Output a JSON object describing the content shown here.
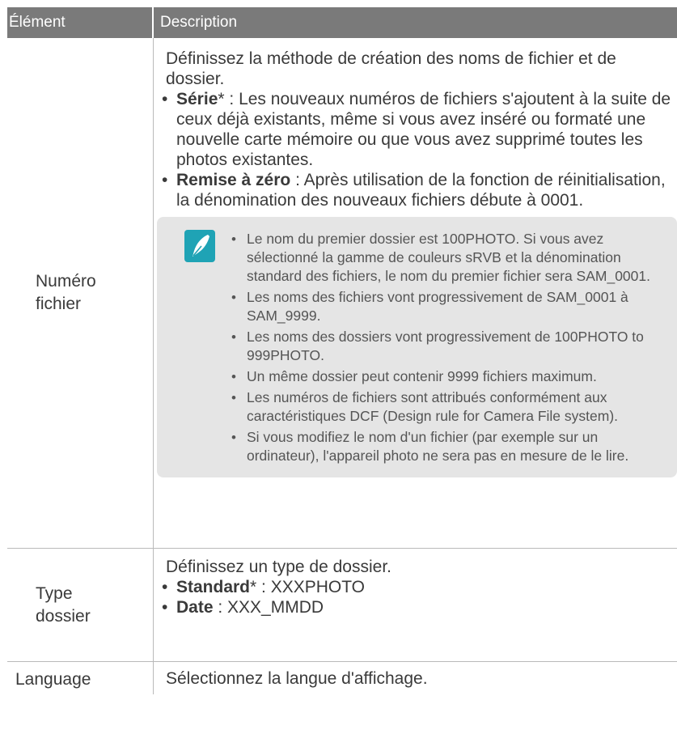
{
  "header": {
    "col1": "Élément",
    "col2": "Description"
  },
  "rows": [
    {
      "label_lines": [
        "Numéro",
        "fichier"
      ],
      "intro": "Définissez la méthode de création des noms de fichier et de dossier.",
      "options": [
        {
          "name": "Série",
          "mark": "*",
          "text": " : Les nouveaux numéros de fichiers s'ajoutent à la suite de ceux déjà existants, même si vous avez inséré ou formaté une nouvelle carte mémoire ou que vous avez supprimé toutes les photos existantes."
        },
        {
          "name": "Remise à zéro",
          "mark": "",
          "text": " : Après utilisation de la fonction de réinitialisation, la dénomination des nouveaux fichiers débute à 0001."
        }
      ],
      "notes": [
        "Le nom du premier dossier est 100PHOTO. Si vous avez sélectionné la gamme de couleurs sRVB et la dénomination standard des fichiers, le nom du premier fichier sera SAM_0001.",
        "Les noms des fichiers vont progressivement de SAM_0001 à SAM_9999.",
        "Les noms des dossiers vont progressivement de 100PHOTO to 999PHOTO.",
        "Un même dossier peut contenir 9999 fichiers maximum.",
        "Les numéros de fichiers sont attribués conformément aux caractéristiques DCF (Design rule for Camera File system).",
        "Si vous modifiez le nom d'un fichier (par exemple sur un ordinateur), l'appareil photo ne sera pas en mesure de le lire."
      ]
    },
    {
      "label_lines": [
        "Type",
        "dossier"
      ],
      "intro": "Définissez un type de dossier.",
      "options": [
        {
          "name": "Standard",
          "mark": "*",
          "text": " : XXXPHOTO"
        },
        {
          "name": "Date",
          "mark": "",
          "text": " : XXX_MMDD"
        }
      ]
    },
    {
      "label_lines": [
        "Language"
      ],
      "intro": "Sélectionnez la langue d'affichage."
    }
  ],
  "colors": {
    "header_bg": "#7a7a7a",
    "note_bg": "#e5e5e5",
    "note_icon": "#1fa3b5",
    "text": "#3a3a3a"
  },
  "icons": {
    "note": "note-pen-icon"
  }
}
